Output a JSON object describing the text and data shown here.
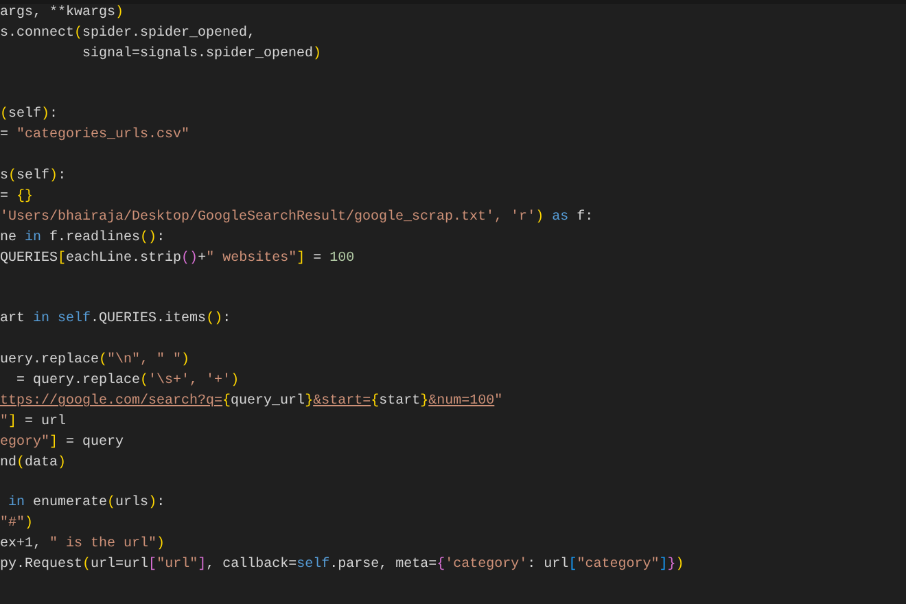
{
  "editor": {
    "lines": [
      {
        "kind": "code",
        "tokens": [
          {
            "text": "args, **kwargs",
            "kind": "plain"
          },
          {
            "text": ")",
            "kind": "bracket1"
          }
        ]
      },
      {
        "kind": "code",
        "tokens": [
          {
            "text": "s.connect",
            "kind": "plain"
          },
          {
            "text": "(",
            "kind": "bracket1"
          },
          {
            "text": "spider.spider_opened,",
            "kind": "plain"
          }
        ]
      },
      {
        "kind": "code",
        "tokens": [
          {
            "text": "          signal=signals.spider_opened",
            "kind": "plain"
          },
          {
            "text": ")",
            "kind": "bracket1"
          }
        ]
      },
      {
        "kind": "blank"
      },
      {
        "kind": "blank"
      },
      {
        "kind": "code",
        "tokens": [
          {
            "text": "(",
            "kind": "bracket1"
          },
          {
            "text": "self",
            "kind": "plain"
          },
          {
            "text": ")",
            "kind": "bracket1"
          },
          {
            "text": ":",
            "kind": "plain"
          }
        ]
      },
      {
        "kind": "code",
        "tokens": [
          {
            "text": "= ",
            "kind": "plain"
          },
          {
            "text": "\"categories_urls.csv\"",
            "kind": "string"
          }
        ]
      },
      {
        "kind": "blank"
      },
      {
        "kind": "code",
        "tokens": [
          {
            "text": "s",
            "kind": "plain"
          },
          {
            "text": "(",
            "kind": "bracket1"
          },
          {
            "text": "self",
            "kind": "plain"
          },
          {
            "text": ")",
            "kind": "bracket1"
          },
          {
            "text": ":",
            "kind": "plain"
          }
        ]
      },
      {
        "kind": "code",
        "tokens": [
          {
            "text": "= ",
            "kind": "plain"
          },
          {
            "text": "{}",
            "kind": "bracket1"
          }
        ]
      },
      {
        "kind": "code",
        "tokens": [
          {
            "text": "'Users/bhairaja/Desktop/GoogleSearchResult/google_scrap.txt', 'r'",
            "kind": "string"
          },
          {
            "text": ")",
            "kind": "bracket1"
          },
          {
            "text": " as",
            "kind": "keyword"
          },
          {
            "text": " f:",
            "kind": "plain"
          }
        ]
      },
      {
        "kind": "code",
        "tokens": [
          {
            "text": "ne ",
            "kind": "plain"
          },
          {
            "text": "in",
            "kind": "keyword"
          },
          {
            "text": " f.readlines",
            "kind": "plain"
          },
          {
            "text": "()",
            "kind": "bracket1"
          },
          {
            "text": ":",
            "kind": "plain"
          }
        ]
      },
      {
        "kind": "code",
        "tokens": [
          {
            "text": "QUERIES",
            "kind": "plain"
          },
          {
            "text": "[",
            "kind": "bracket1"
          },
          {
            "text": "eachLine.strip",
            "kind": "plain"
          },
          {
            "text": "()",
            "kind": "bracket2"
          },
          {
            "text": "+",
            "kind": "plain"
          },
          {
            "text": "\" websites\"",
            "kind": "string"
          },
          {
            "text": "]",
            "kind": "bracket1"
          },
          {
            "text": " = ",
            "kind": "plain"
          },
          {
            "text": "100",
            "kind": "number"
          }
        ]
      },
      {
        "kind": "blank"
      },
      {
        "kind": "blank"
      },
      {
        "kind": "code",
        "tokens": [
          {
            "text": "art ",
            "kind": "plain"
          },
          {
            "text": "in",
            "kind": "keyword"
          },
          {
            "text": " self",
            "kind": "keyword"
          },
          {
            "text": ".QUERIES.items",
            "kind": "plain"
          },
          {
            "text": "()",
            "kind": "bracket1"
          },
          {
            "text": ":",
            "kind": "plain"
          }
        ]
      },
      {
        "kind": "blank"
      },
      {
        "kind": "code",
        "tokens": [
          {
            "text": "uery.replace",
            "kind": "plain"
          },
          {
            "text": "(",
            "kind": "bracket1"
          },
          {
            "text": "\"\\n\", \" \"",
            "kind": "string"
          },
          {
            "text": ")",
            "kind": "bracket1"
          }
        ]
      },
      {
        "kind": "code",
        "tokens": [
          {
            "text": "  = query.replace",
            "kind": "plain"
          },
          {
            "text": "(",
            "kind": "bracket1"
          },
          {
            "text": "'\\s+', '+'",
            "kind": "string"
          },
          {
            "text": ")",
            "kind": "bracket1"
          }
        ]
      },
      {
        "kind": "code",
        "tokens": [
          {
            "text": "ttps://google.com/search?q=",
            "kind": "link"
          },
          {
            "text": "{",
            "kind": "bracket1"
          },
          {
            "text": "query_url",
            "kind": "plain"
          },
          {
            "text": "}",
            "kind": "bracket1"
          },
          {
            "text": "&start=",
            "kind": "link"
          },
          {
            "text": "{",
            "kind": "bracket1"
          },
          {
            "text": "start",
            "kind": "plain"
          },
          {
            "text": "}",
            "kind": "bracket1"
          },
          {
            "text": "&num=100",
            "kind": "link"
          },
          {
            "text": "\"",
            "kind": "string"
          }
        ]
      },
      {
        "kind": "code",
        "tokens": [
          {
            "text": "\"",
            "kind": "string"
          },
          {
            "text": "]",
            "kind": "bracket1"
          },
          {
            "text": " = url",
            "kind": "plain"
          }
        ]
      },
      {
        "kind": "code",
        "tokens": [
          {
            "text": "egory\"",
            "kind": "string"
          },
          {
            "text": "]",
            "kind": "bracket1"
          },
          {
            "text": " = query",
            "kind": "plain"
          }
        ]
      },
      {
        "kind": "code",
        "tokens": [
          {
            "text": "nd",
            "kind": "plain"
          },
          {
            "text": "(",
            "kind": "bracket1"
          },
          {
            "text": "data",
            "kind": "plain"
          },
          {
            "text": ")",
            "kind": "bracket1"
          }
        ]
      },
      {
        "kind": "blank"
      },
      {
        "kind": "code",
        "tokens": [
          {
            "text": " in",
            "kind": "keyword"
          },
          {
            "text": " enumerate",
            "kind": "plain"
          },
          {
            "text": "(",
            "kind": "bracket1"
          },
          {
            "text": "urls",
            "kind": "plain"
          },
          {
            "text": ")",
            "kind": "bracket1"
          },
          {
            "text": ":",
            "kind": "plain"
          }
        ]
      },
      {
        "kind": "code",
        "tokens": [
          {
            "text": "\"#\"",
            "kind": "string"
          },
          {
            "text": ")",
            "kind": "bracket1"
          }
        ]
      },
      {
        "kind": "code",
        "tokens": [
          {
            "text": "ex+1, ",
            "kind": "plain"
          },
          {
            "text": "\" is the url\"",
            "kind": "string"
          },
          {
            "text": ")",
            "kind": "bracket1"
          }
        ]
      },
      {
        "kind": "code",
        "tokens": [
          {
            "text": "py.Request",
            "kind": "plain"
          },
          {
            "text": "(",
            "kind": "bracket1"
          },
          {
            "text": "url=url",
            "kind": "plain"
          },
          {
            "text": "[",
            "kind": "bracket2"
          },
          {
            "text": "\"url\"",
            "kind": "string"
          },
          {
            "text": "]",
            "kind": "bracket2"
          },
          {
            "text": ", callback=",
            "kind": "plain"
          },
          {
            "text": "self",
            "kind": "keyword"
          },
          {
            "text": ".parse, meta=",
            "kind": "plain"
          },
          {
            "text": "{",
            "kind": "bracket2"
          },
          {
            "text": "'category'",
            "kind": "string"
          },
          {
            "text": ": url",
            "kind": "plain"
          },
          {
            "text": "[",
            "kind": "bracket3"
          },
          {
            "text": "\"category\"",
            "kind": "string"
          },
          {
            "text": "]",
            "kind": "bracket3"
          },
          {
            "text": "}",
            "kind": "bracket2"
          },
          {
            "text": ")",
            "kind": "bracket1"
          }
        ]
      }
    ]
  }
}
